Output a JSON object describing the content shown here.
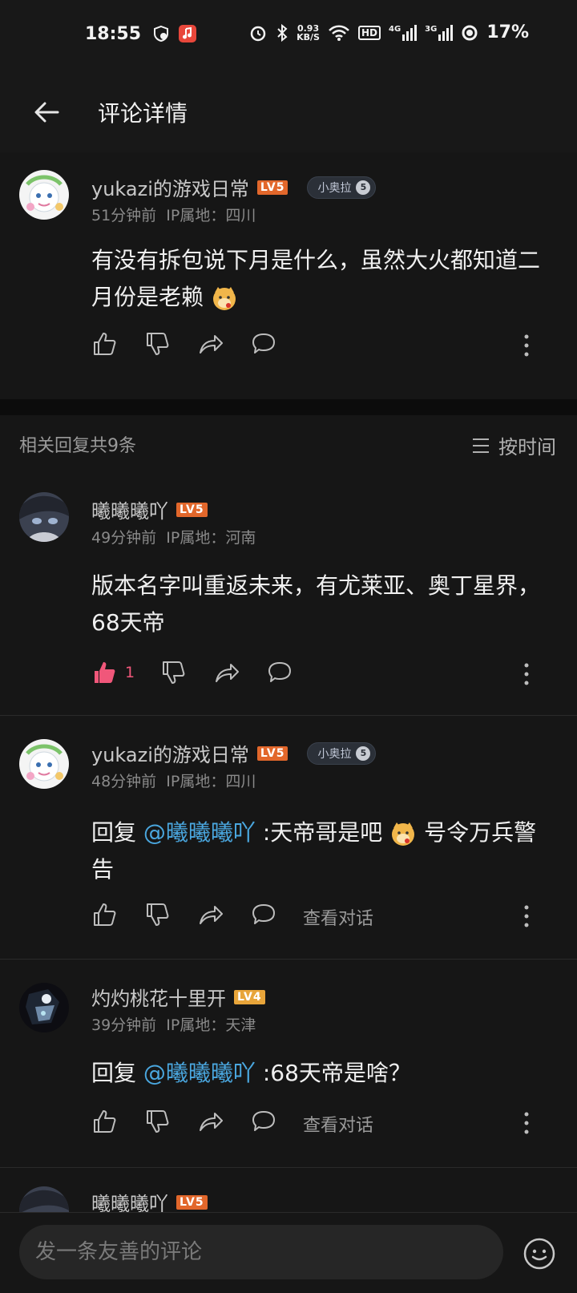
{
  "status_bar": {
    "time": "18:55",
    "net_speed_top": "0.93",
    "net_speed_bottom": "KB/S",
    "network_labels": [
      "HD",
      "4G",
      "3G"
    ],
    "battery": "17%"
  },
  "header": {
    "title": "评论详情"
  },
  "main_comment": {
    "username": "yukazi的游戏日常",
    "level": "LV5",
    "tag_label": "小奥拉",
    "tag_number": "5",
    "time": "51分钟前",
    "ip": "IP属地：四川",
    "text": "有没有拆包说下月是什么，虽然大火都知道二月份是老赖"
  },
  "replies_header": {
    "count_label": "相关回复共9条",
    "sort_label": "按时间"
  },
  "replies": [
    {
      "username": "曦曦曦吖",
      "level": "LV5",
      "time": "49分钟前",
      "ip": "IP属地：河南",
      "text": "版本名字叫重返未来，有尤莱亚、奥丁星界，68天帝",
      "like_count": "1"
    },
    {
      "username": "yukazi的游戏日常",
      "level": "LV5",
      "tag_label": "小奥拉",
      "tag_number": "5",
      "time": "48分钟前",
      "ip": "IP属地：四川",
      "reply_prefix": "回复 ",
      "mention": "@曦曦曦吖",
      "text_before_emoji": " :天帝哥是吧",
      "text_after_emoji": " 号令万兵警告",
      "dialog_link": "查看对话"
    },
    {
      "username": "灼灼桃花十里开",
      "level": "LV4",
      "time": "39分钟前",
      "ip": "IP属地：天津",
      "reply_prefix": "回复 ",
      "mention": "@曦曦曦吖",
      "text": " :68天帝是啥？",
      "dialog_link": "查看对话"
    },
    {
      "username": "曦曦曦吖",
      "level": "LV5"
    }
  ],
  "comment_input": {
    "placeholder": "发一条友善的评论"
  },
  "colors": {
    "background": "#161616",
    "accent_mention": "#4aa7df",
    "liked": "#f0577a",
    "level_badge": "#e2672b"
  }
}
